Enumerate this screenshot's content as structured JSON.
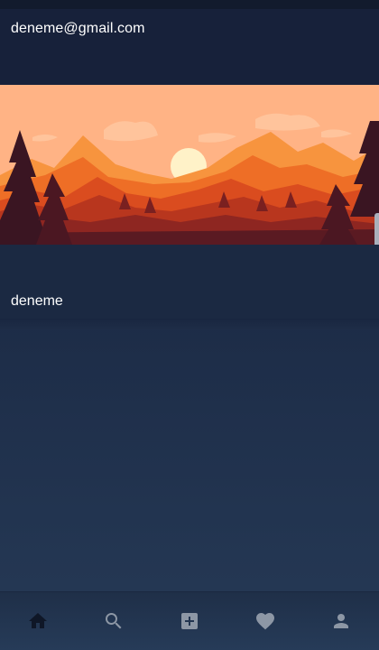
{
  "profile": {
    "email": "deneme@gmail.com",
    "username": "deneme",
    "banner_image": "sunset-mountain-forest-illustration"
  },
  "bottom_nav": {
    "items": [
      {
        "icon": "home-icon",
        "active": true
      },
      {
        "icon": "search-icon",
        "active": false
      },
      {
        "icon": "add-box-icon",
        "active": false
      },
      {
        "icon": "heart-icon",
        "active": false
      },
      {
        "icon": "person-icon",
        "active": false
      }
    ]
  },
  "colors": {
    "header_bg": "#17213a",
    "body_bg": "#1c2b46",
    "nav_bg": "#243753",
    "nav_active_icon": "#0f1727",
    "nav_inactive_icon": "#8d97a5",
    "text": "#ffffff"
  }
}
